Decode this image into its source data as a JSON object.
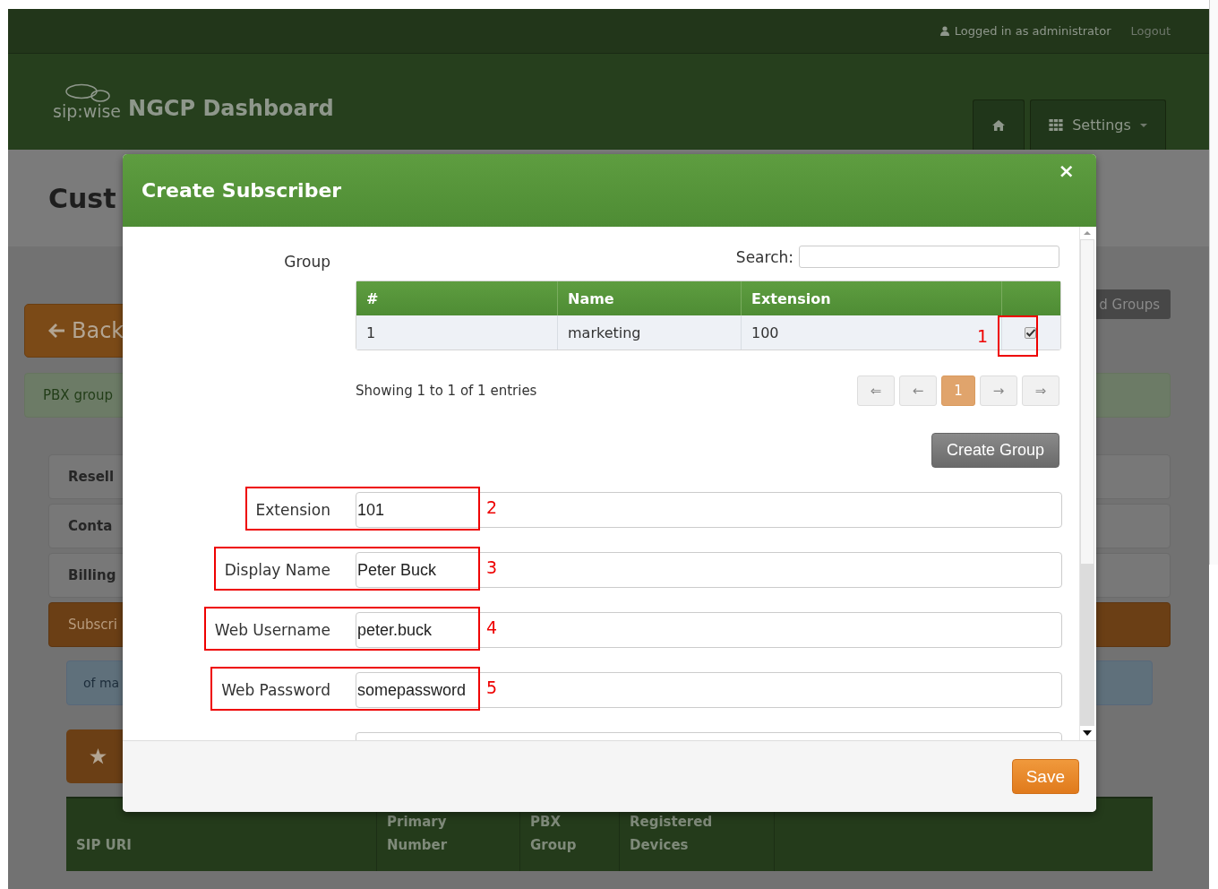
{
  "top_bar": {
    "user": "Logged in as administrator",
    "logout": "Logout"
  },
  "header": {
    "logo": "sip:wise",
    "title": "NGCP Dashboard",
    "settings": "Settings"
  },
  "page": {
    "heading": "Cust",
    "back": "Back",
    "groups_button": "d Groups",
    "alert": "PBX group",
    "sections": [
      {
        "label": "Resell",
        "selected": false
      },
      {
        "label": "Conta",
        "selected": false
      },
      {
        "label": "Billing",
        "selected": false
      },
      {
        "label": "Subscri",
        "selected": true
      }
    ],
    "info": "of ma",
    "table": {
      "columns": [
        "SIP URI",
        "Primary Number",
        "PBX Group",
        "Registered Devices"
      ]
    }
  },
  "modal": {
    "title": "Create Subscriber",
    "close": "×",
    "group_label": "Group",
    "search_label": "Search:",
    "group_table": {
      "columns": [
        "#",
        "Name",
        "Extension"
      ],
      "rows": [
        {
          "cells": [
            "1",
            "marketing",
            "100"
          ],
          "checked": true,
          "annotation": "1"
        }
      ]
    },
    "info": "Showing 1 to 1 of 1 entries",
    "pagination": [
      {
        "label": "⇐",
        "selected": false
      },
      {
        "label": "←",
        "selected": false
      },
      {
        "label": "1",
        "selected": true
      },
      {
        "label": "→",
        "selected": false
      },
      {
        "label": "⇒",
        "selected": false
      }
    ],
    "create_group": "Create Group",
    "fields": [
      {
        "label": "Extension",
        "value": "101",
        "annotation": "2"
      },
      {
        "label": "Display Name",
        "value": "Peter Buck",
        "annotation": "3"
      },
      {
        "label": "Web Username",
        "value": "peter.buck",
        "annotation": "4"
      },
      {
        "label": "Web Password",
        "value": "somepassword",
        "annotation": "5"
      }
    ],
    "save": "Save"
  }
}
